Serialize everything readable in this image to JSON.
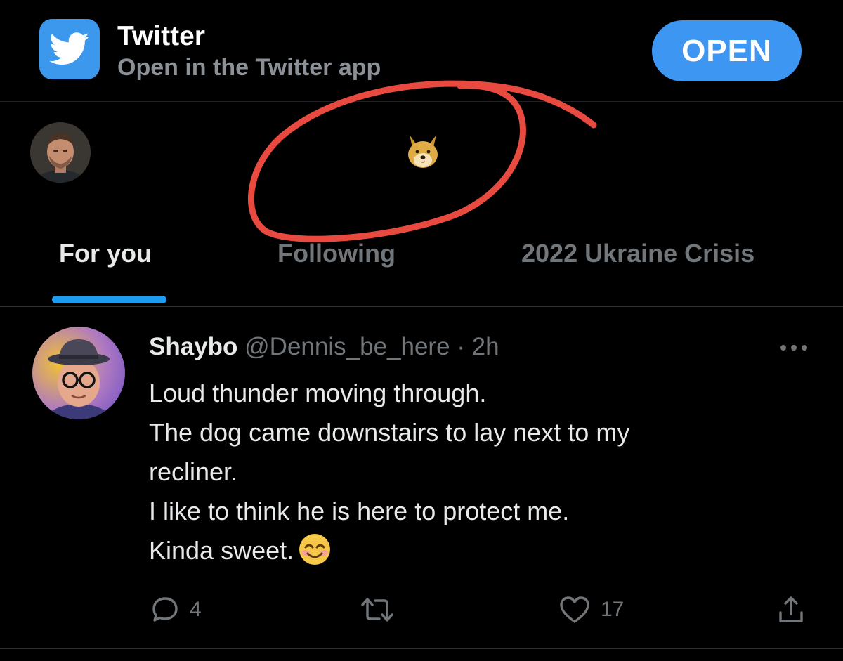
{
  "banner": {
    "app_name": "Twitter",
    "subtitle": "Open in the Twitter app",
    "open_label": "OPEN",
    "accent": "#3d96f1"
  },
  "header": {
    "logo_icon": "doge-icon",
    "annotation_color": "#e84a3f"
  },
  "tabs": [
    {
      "label": "For you",
      "active": true
    },
    {
      "label": "Following",
      "active": false
    },
    {
      "label": "2022 Ukraine Crisis",
      "active": false
    }
  ],
  "tweet": {
    "display_name": "Shaybo",
    "handle": "@Dennis_be_here",
    "separator": "·",
    "time": "2h",
    "lines": [
      "Loud thunder moving through.",
      "The dog came downstairs to lay next to my",
      "recliner.",
      "I like to think he is here to  protect me.",
      "Kinda sweet."
    ],
    "emoji": "smiling-face-with-smiling-eyes",
    "reply_count": "4",
    "like_count": "17"
  }
}
